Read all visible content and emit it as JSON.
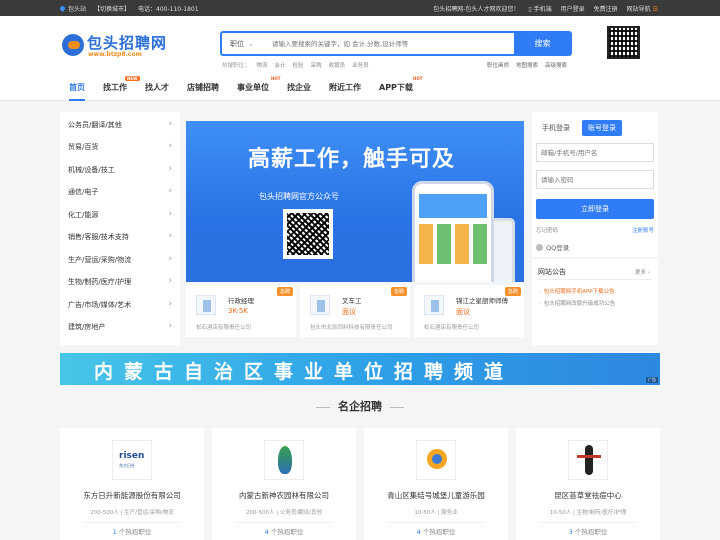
{
  "topbar": {
    "site": "包头站",
    "switch_city": "【切换城市】",
    "phone": "电话：400-110-1801",
    "welcome": "包头招聘网-包头人才网欢迎您！",
    "mobile": "手机端",
    "user_login": "用户登录",
    "free_register": "免费注册",
    "site_nav": "网站导航"
  },
  "logo": {
    "text": "包头招聘网",
    "url": "www.btzp8.com"
  },
  "search": {
    "category": "职位",
    "placeholder": "请输入要搜索的关键字，如 会计,分数,设计师等",
    "button": "搜索",
    "hot_label": "热搜职位：",
    "hot_items": [
      "物流",
      "会计",
      "检验",
      "采购",
      "收银员",
      "业务员"
    ],
    "links": [
      "职位画师",
      "地图搜索",
      "高级搜索"
    ]
  },
  "nav": {
    "items": [
      "首页",
      "找工作",
      "找人才",
      "店铺招聘",
      "事业单位",
      "找企业",
      "附近工作",
      "APP下载"
    ],
    "badges": {
      "new": "NEW",
      "hot": "HOT"
    }
  },
  "categories": [
    "公务员/翻译/其他",
    "贸易/百货",
    "机械/设备/技工",
    "通信/电子",
    "化工/能源",
    "销售/客服/技术支持",
    "生产/营运/采购/物流",
    "生物/制药/医疗/护理",
    "广告/市场/媒体/艺术",
    "建筑/房地产"
  ],
  "banner": {
    "headline": "高薪工作，触手可及",
    "subtitle": "包头招聘网官方公众号"
  },
  "featured_jobs": [
    {
      "title": "行政经理",
      "salary": "3K-5K",
      "company": "松石酒店有限责任公司",
      "tag": "急聘"
    },
    {
      "title": "叉车工",
      "salary": "面议",
      "company": "包头市北辰饲料科技有限责任公司",
      "tag": "急聘"
    },
    {
      "title": "锦江之星厨师师傅",
      "salary": "面议",
      "company": "松石酒店有限责任公司",
      "tag": "急聘"
    }
  ],
  "login": {
    "tab_mobile": "手机登录",
    "tab_account": "账号登录",
    "username_placeholder": "邮箱/手机号/用户名",
    "password_placeholder": "请输入密码",
    "submit": "立即登录",
    "forgot": "忘记密码",
    "register": "注册账号",
    "qq": "QQ登录"
  },
  "notice": {
    "title": "网站公告",
    "more": "更多 ›",
    "items": [
      "包头招聘网手机APP下载公告",
      "包头招聘网改版升级成功公告"
    ]
  },
  "promo_banner": {
    "text": "内蒙古自治区事业单位招聘频道",
    "ad": "广告"
  },
  "section_title": "名企招聘",
  "companies": [
    {
      "name": "东方日升新能源股份有限公司",
      "size": "200-500人",
      "industry": "生产/营运/采购/物流",
      "count": "1",
      "count_label": "个热招职位"
    },
    {
      "name": "内蒙古新神农园林有限公司",
      "size": "200-500人",
      "industry": "公务员/翻译/其他",
      "count": "4",
      "count_label": "个热招职位"
    },
    {
      "name": "青山区集结号城堡儿童游乐园",
      "size": "10-50人",
      "industry": "服务业",
      "count": "4",
      "count_label": "个热招职位"
    },
    {
      "name": "昆区荟草堂祛痘中心",
      "size": "10-50人",
      "industry": "生物/制药/医疗/护理",
      "count": "3",
      "count_label": "个热招职位"
    }
  ],
  "colors": {
    "primary": "#2f7cf6",
    "accent": "#f28c1b",
    "salary": "#f26b1d"
  }
}
